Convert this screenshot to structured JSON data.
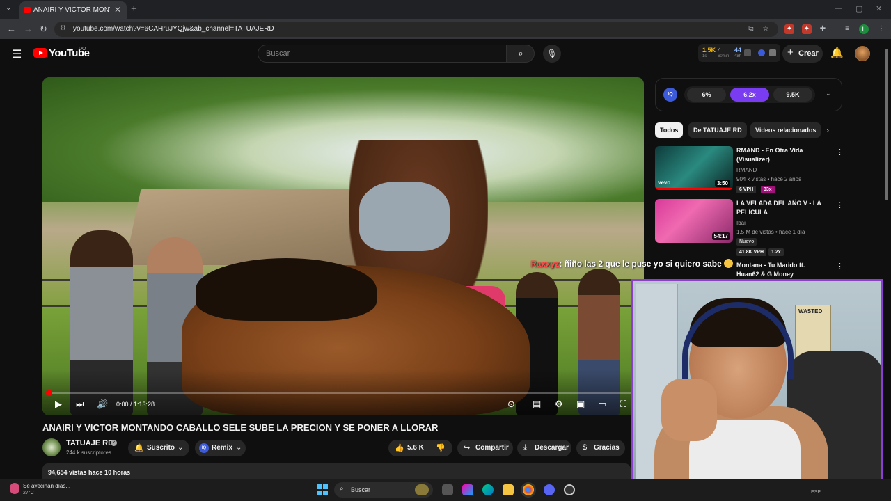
{
  "browser": {
    "tab_title": "ANAIRI Y VICTOR MONTANDO",
    "url": "youtube.com/watch?v=6CAHruJYQjw&ab_channel=TATUAJERD"
  },
  "header": {
    "logo_text": "YouTube",
    "country": "DO",
    "search_placeholder": "Buscar",
    "stats": {
      "v1": "1.5K",
      "s1": "1s",
      "v2": "4",
      "s2": "60min",
      "v3": "44",
      "s3": "48h"
    },
    "create_label": "Crear"
  },
  "player": {
    "time": "0:00 / 1:13:28",
    "progress_fraction": 0.0
  },
  "video": {
    "title": "ANAIRI Y VICTOR MONTANDO CABALLO SELE SUBE LA PRECION Y SE PONER A LLORAR",
    "channel": "TATUAJE RD",
    "subscribers": "244 k suscriptores",
    "subscribed_label": "Suscrito",
    "remix_label": "Remix",
    "iq_label": "IQ",
    "likes": "5.6 K",
    "share_label": "Compartir",
    "download_label": "Descargar",
    "thanks_label": "Gracias",
    "views_line": "94,654 vistas  hace 10 horas"
  },
  "iq_panel": {
    "logo": "IQ",
    "values": [
      "6%",
      "6.2x",
      "9.5K"
    ]
  },
  "chips": [
    "Todos",
    "De TATUAJE RD",
    "Videos relacionados"
  ],
  "recommendations": [
    {
      "title": "RMAND - En Otra Vida (Visualizer)",
      "channel": "RMAND",
      "meta": "904 k vistas • hace 2 años",
      "duration": "3:50",
      "thumb_label": "vevo",
      "badges": [
        "6 VPH",
        "33x"
      ]
    },
    {
      "title": "LA VELADA DEL AÑO V - LA PELÍCULA",
      "channel": "Ibai",
      "meta": "1.5 M de vistas • hace 1 día",
      "duration": "54:17",
      "new_label": "Nuevo",
      "badges": [
        "41.8K VPH",
        "1.2x"
      ]
    }
  ],
  "partial_rec": {
    "line1": "Montana - Tu Marido ft.",
    "line2": "Huan62 & G Money"
  },
  "chat": {
    "user": "Raxxyz",
    "message": ": ñiño las 2 que le puse yo si quiero sabe"
  },
  "cam": {
    "poster_text": "WASTED"
  },
  "taskbar": {
    "weather_text": "Se avecinan días...",
    "temperature": "27°C",
    "search_label": "Buscar",
    "tray_text": "ESP"
  }
}
